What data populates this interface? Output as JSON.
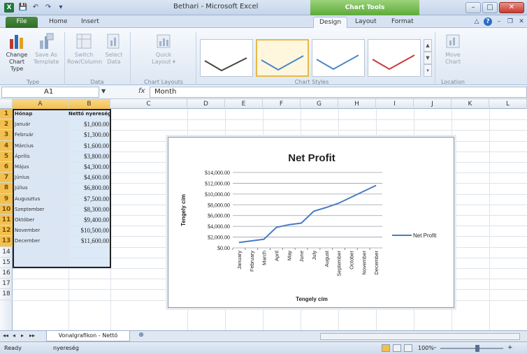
{
  "window": {
    "title": "Bethari - Microsoft Excel",
    "chart_tools_label": "Chart Tools",
    "minimize": "–",
    "maximize": "□",
    "close": "✕"
  },
  "qat": {
    "save": "💾",
    "undo": "↶",
    "redo": "↷",
    "customize": "▾"
  },
  "tabs": {
    "file": "File",
    "home": "Home",
    "insert": "Insert",
    "design": "Design",
    "layout": "Layout",
    "format": "Format"
  },
  "ribbon": {
    "change_chart_type": "Change\nChart Type",
    "save_as_template": "Save As\nTemplate",
    "switch_row_column": "Switch\nRow/Column",
    "select_data": "Select\nData",
    "quick_layout": "Quick\nLayout ▾",
    "move_chart": "Move\nChart",
    "group_type": "Type",
    "group_data": "Data",
    "group_chart_layouts": "Chart Layouts",
    "group_chart_styles": "Chart Styles",
    "group_location": "Location",
    "style_colors": [
      "#444444",
      "#4a86c8",
      "#4a86c8",
      "#c83a3a"
    ]
  },
  "formula": {
    "name_box": "A1",
    "fx": "fx",
    "value": "Month"
  },
  "columns": [
    "A",
    "B",
    "C",
    "D",
    "E",
    "F",
    "G",
    "H",
    "I",
    "J",
    "K",
    "L"
  ],
  "rows": [
    "1",
    "2",
    "3",
    "4",
    "5",
    "6",
    "7",
    "8",
    "9",
    "10",
    "11",
    "12",
    "13",
    "14",
    "15",
    "16",
    "17",
    "18"
  ],
  "sheet_data": {
    "header": [
      "Hónap",
      "Nettó nyereség"
    ],
    "rows": [
      [
        "Január",
        "$1,000.00"
      ],
      [
        "Február",
        "$1,300.00"
      ],
      [
        "Március",
        "$1,600.00"
      ],
      [
        "Április",
        "$3,800.00"
      ],
      [
        "Május",
        "$4,300.00"
      ],
      [
        "Június",
        "$4,600.00"
      ],
      [
        "Július",
        "$6,800.00"
      ],
      [
        "Augusztus",
        "$7,500.00"
      ],
      [
        "Szeptember",
        "$8,300.00"
      ],
      [
        "Október",
        "$9,400.00"
      ],
      [
        "November",
        "$10,500.00"
      ],
      [
        "December",
        "$11,600.00"
      ]
    ]
  },
  "chart_data": {
    "type": "line",
    "title": "Net Profit",
    "xlabel": "Tengely cím",
    "ylabel": "Tengely cím",
    "categories": [
      "January",
      "February",
      "March",
      "April",
      "May",
      "June",
      "July",
      "August",
      "September",
      "October",
      "November",
      "December"
    ],
    "series": [
      {
        "name": "Net Profit",
        "color": "#4a7cc0",
        "values": [
          1000,
          1300,
          1600,
          3800,
          4300,
          4600,
          6800,
          7500,
          8300,
          9400,
          10500,
          11600
        ]
      }
    ],
    "ylim": [
      0,
      14000
    ],
    "yticks": [
      "$0.00",
      "$2,000.00",
      "$4,000.00",
      "$6,000.00",
      "$8,000.00",
      "$10,000.00",
      "$12,000.00",
      "$14,000.00"
    ],
    "grid": true,
    "legend": "right"
  },
  "sheetbar": {
    "nav": [
      "◂◂",
      "◂",
      "▸",
      "▸▸"
    ],
    "tab": "Vonalgrafikon - Nettó",
    "new": "⊕"
  },
  "status": {
    "mode": "Ready",
    "name": "nyereség",
    "zoom": "100%",
    "zoom_minus": "–",
    "zoom_plus": "+"
  }
}
